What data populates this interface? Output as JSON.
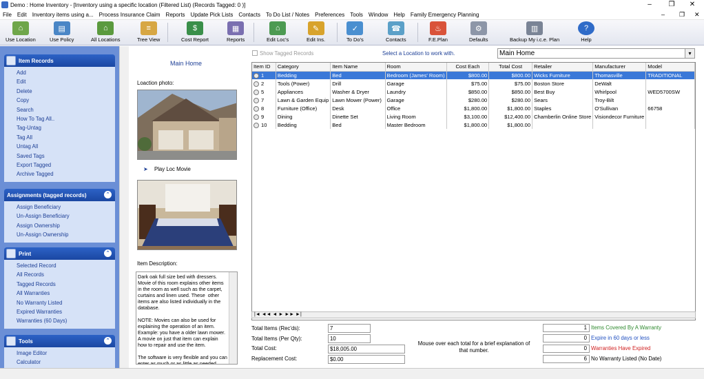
{
  "window": {
    "title": "Demo : Home Inventory - [Inventory using a specific location (Filtered List)  (Records Tagged:  0 )]",
    "minimize": "–",
    "restore": "❐",
    "close": "✕",
    "mdi_minimize": "–",
    "mdi_restore": "❐",
    "mdi_close": "✕"
  },
  "menu": [
    "File",
    "Edit",
    "Inventory items using a...",
    "Process Insurance Claim",
    "Reports",
    "Update Pick Lists",
    "Contacts",
    "To Do List / Notes",
    "Preferences",
    "Tools",
    "Window",
    "Help",
    "Family Emergency Planning"
  ],
  "toolbar": [
    {
      "label": "Use Location",
      "icon": "use-location-icon",
      "color": "#6fa64a"
    },
    {
      "label": "Use Policy",
      "icon": "use-policy-icon",
      "color": "#4a86c6"
    },
    {
      "label": "All Locations",
      "icon": "all-locations-icon",
      "color": "#5b9a3e"
    },
    {
      "label": "Tree View",
      "icon": "tree-view-icon",
      "color": "#d7a744"
    },
    {
      "label": "Cost Report",
      "icon": "cost-report-icon",
      "color": "#3a8f4a"
    },
    {
      "label": "Reports",
      "icon": "reports-icon",
      "color": "#7a6fb0"
    },
    {
      "label": "Edit Loc's",
      "icon": "edit-locations-icon",
      "color": "#4c9a52"
    },
    {
      "label": "Edit Ins.",
      "icon": "edit-insurance-icon",
      "color": "#d8a32c"
    },
    {
      "label": "To Do's",
      "icon": "to-dos-icon",
      "color": "#4a8fd0"
    },
    {
      "label": "Contacts",
      "icon": "contacts-icon",
      "color": "#5ba0c8"
    },
    {
      "label": "F.E.Plan",
      "icon": "fe-plan-icon",
      "color": "#d9533a"
    },
    {
      "label": "Defaults",
      "icon": "defaults-icon",
      "color": "#8d96a8"
    },
    {
      "label": "Backup My i.c.e. Plan",
      "icon": "backup-icon",
      "color": "#7a8496"
    },
    {
      "label": "Help",
      "icon": "help-icon",
      "color": "#2f6bc8"
    }
  ],
  "sidebar": {
    "item_records": {
      "title": "Item Records",
      "items": [
        "Add",
        "Edit",
        "Delete",
        "Copy",
        "Search",
        "How To Tag All..",
        "Tag-Untag",
        "Tag All",
        "Untag All",
        "Saved Tags",
        "Export Tagged",
        "Archive Tagged"
      ]
    },
    "assignments": {
      "title": "Assignments (tagged records)",
      "items": [
        "Assign Beneficiary",
        "Un-Assign Beneficiary",
        "Assign Ownership",
        "Un-Assign Ownership"
      ]
    },
    "print": {
      "title": "Print",
      "items": [
        "Selected Record",
        "All Records",
        "Tagged Records",
        "All Warranties",
        "No Warranty Listed",
        "Expired Warranties",
        "Warranties (60 Days)"
      ]
    },
    "tools": {
      "title": "Tools",
      "items": [
        "Image Editor",
        "Calculator"
      ]
    }
  },
  "location_panel": {
    "name": "Main Home",
    "photo_label": "Loaction photo:",
    "play_movie": "Play Loc Movie",
    "desc_label": "Item Description:",
    "description": "Dark oak full size bed with dressers. Movie of this room explains other items in the room as well such as the carpet, curtains and linen used. These  other items are also listed individually in the database.\n\nNOTE: Movies can also be used for explaining the operation of an item. Example: you have a older lawn mower. A movie on just that item can explain how to repair and use the item.\n\nThe software is very flexible and you can enter as much or as little as needed. Your"
  },
  "filter": {
    "show_tagged": "Show Tagged Records",
    "select_prompt": "Select a Location to work with.",
    "location_value": "Main Home"
  },
  "grid": {
    "columns": [
      "Item ID",
      "Category",
      "Item Name",
      "Room",
      "Cost Each",
      "Total Cost",
      "Retailer",
      "Manufacturer",
      "Model"
    ],
    "rows": [
      [
        "1",
        "Bedding",
        "Bed",
        "Bedroom (James' Room)",
        "$800.00",
        "$800.00",
        "Wicks Furniture",
        "Thomasville",
        "TRADITIONAL"
      ],
      [
        "2",
        "Tools (Power)",
        "Drill",
        "Garage",
        "$75.00",
        "$75.00",
        "Boston Store",
        "DeWalt",
        ""
      ],
      [
        "5",
        "Appliances",
        "Washer & Dryer",
        "Laundry",
        "$850.00",
        "$850.00",
        "Best Buy",
        "Whirlpool",
        "WED5700SW"
      ],
      [
        "7",
        "Lawn & Garden Equip",
        "Lawn Mower (Power)",
        "Garage",
        "$280.00",
        "$280.00",
        "Sears",
        "Troy-Bilt",
        ""
      ],
      [
        "8",
        "Furniture (Office)",
        "Desk",
        "Office",
        "$1,800.00",
        "$1,800.00",
        "Staples",
        "O'Sullivan",
        "66758"
      ],
      [
        "9",
        "Dining",
        "Dinette Set",
        "Living Room",
        "$3,100.00",
        "$12,400.00",
        "Chamberlin Online Store",
        "Visiondecor Furniture",
        ""
      ],
      [
        "10",
        "Bedding",
        "Bed",
        "Master Bedroom",
        "$1,800.00",
        "$1,800.00",
        "",
        "",
        ""
      ]
    ],
    "nav": "|◄  ◄◄  ◄  ►  ►►  ►|"
  },
  "totals": {
    "total_items_recs_label": "Total Items (Rec'ds):",
    "total_items_recs": "7",
    "total_items_qty_label": "Total Items (Per Qty):",
    "total_items_qty": "10",
    "total_cost_label": "Total Cost:",
    "total_cost": "$18,005.00",
    "replacement_cost_label": "Replacement Cost:",
    "replacement_cost": "$0.00",
    "hint": "Mouse over each total for a brief explanation of that number."
  },
  "warranty": [
    {
      "count": "1",
      "label": "Items Covered By A Warranty",
      "color": "#2f8a2f"
    },
    {
      "count": "0",
      "label": "Expire in 60 days or less",
      "color": "#1f4fc0"
    },
    {
      "count": "0",
      "label": "Warranties Have Expired",
      "color": "#d02020"
    },
    {
      "count": "6",
      "label": "No Warranty Listed (No Date)",
      "color": "#000000"
    }
  ]
}
